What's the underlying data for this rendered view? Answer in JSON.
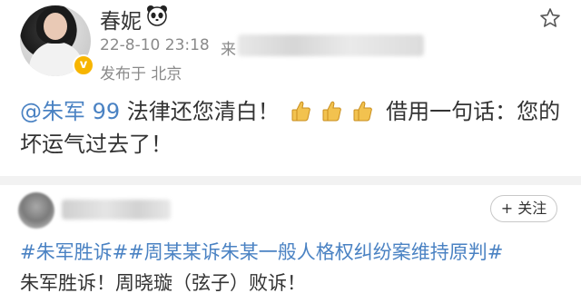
{
  "post": {
    "username": "春妮",
    "badge_icon": "panda-icon",
    "timestamp": "22-8-10 23:18",
    "source_label": "来",
    "location": "发布于 北京",
    "body": {
      "mention": "@朱军 99",
      "text_part1": " 法律还您清白！",
      "emoji": [
        "thumbs-up-icon",
        "thumbs-up-icon",
        "thumbs-up-icon"
      ],
      "text_part2": " 借用一句话：您的坏运气过去了！"
    }
  },
  "repost": {
    "follow_label": "+ 关注",
    "hashtags": "#朱军胜诉##周某某诉朱某一般人格权纠纷案维持原判#",
    "text": "朱军胜诉！周晓璇（弦子）败诉！"
  },
  "colors": {
    "link": "#4a82c3",
    "text": "#333333",
    "meta": "#8a8a8a",
    "verified": "#f7b500"
  }
}
